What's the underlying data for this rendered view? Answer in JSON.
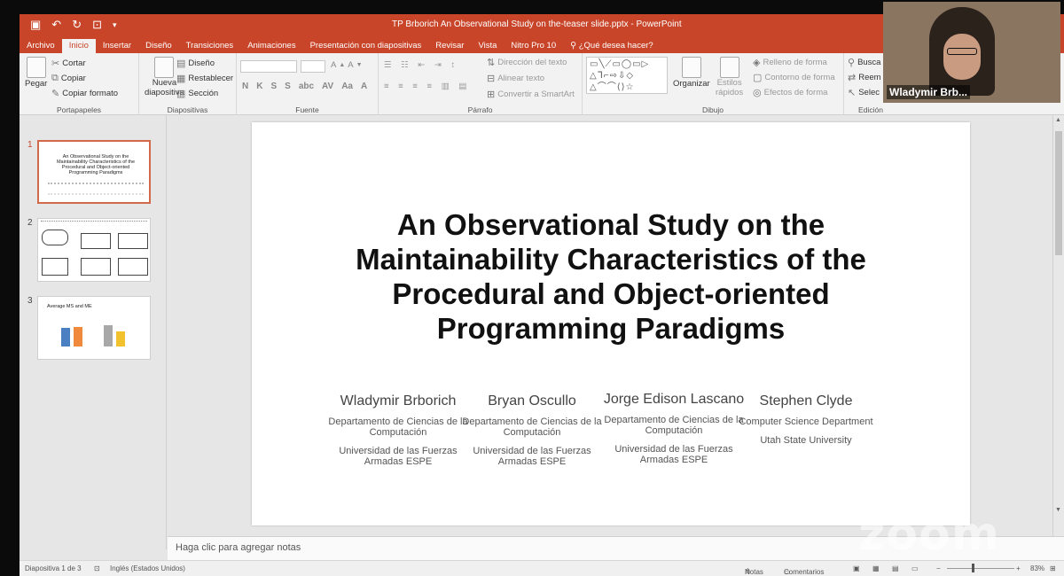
{
  "window": {
    "title": "TP Brborich An Observational Study on the-teaser slide.pptx - PowerPoint",
    "qat_icons": [
      "save-icon",
      "undo-icon",
      "redo-icon",
      "present-icon"
    ]
  },
  "tabs": [
    "Archivo",
    "Inicio",
    "Insertar",
    "Diseño",
    "Transiciones",
    "Animaciones",
    "Presentación con diapositivas",
    "Revisar",
    "Vista",
    "Nitro Pro 10",
    "¿Qué desea hacer?"
  ],
  "ribbon": {
    "clipboard": {
      "pegar": "Pegar",
      "cortar": "Cortar",
      "copiar": "Copiar",
      "copiar_formato": "Copiar formato",
      "label": "Portapapeles"
    },
    "slides": {
      "nueva": "Nueva",
      "diapositiva": "diapositiva",
      "diseno": "Diseño",
      "restablecer": "Restablecer",
      "seccion": "Sección",
      "label": "Diapositivas"
    },
    "font": {
      "label": "Fuente",
      "formats": [
        "N",
        "K",
        "S",
        "S",
        "abc",
        "AV",
        "Aa",
        "A"
      ]
    },
    "paragraph": {
      "direccion": "Dirección del texto",
      "alinear": "Alinear texto",
      "smartart": "Convertir a SmartArt",
      "label": "Párrafo"
    },
    "drawing": {
      "organizar": "Organizar",
      "estilos": "Estilos",
      "rapidos": "rápidos",
      "relleno": "Relleno de forma",
      "contorno": "Contorno de forma",
      "efectos": "Efectos de forma",
      "label": "Dibujo"
    },
    "editing": {
      "buscar": "Busca",
      "reemplazar": "Reem",
      "seleccionar": "Selec",
      "label": "Edición"
    }
  },
  "thumbnails": {
    "numbers": [
      "1",
      "2",
      "3"
    ],
    "slide1_title": "An Observational Study on the Maintainability Characteristics of the Procedural and Object-oriented Programming Paradigms",
    "slide3_title": "Average MS and ME",
    "slide3_values": [
      0.55,
      0.58,
      0.62,
      0.44
    ]
  },
  "slide": {
    "title_lines": [
      "An Observational Study on the",
      "Maintainability Characteristics of the",
      "Procedural and Object-oriented",
      "Programming Paradigms"
    ],
    "authors": [
      {
        "name": "Wladymir Brborich",
        "dept": "Departamento de Ciencias de la Computación",
        "univ": "Universidad de las Fuerzas Armadas ESPE"
      },
      {
        "name": "Bryan Oscullo",
        "dept": "Departamento de Ciencias de la Computación",
        "univ": "Universidad de las Fuerzas Armadas ESPE"
      },
      {
        "name": "Jorge Edison Lascano",
        "dept": "Departamento de Ciencias de la Computación",
        "univ": "Universidad de las Fuerzas Armadas ESPE"
      },
      {
        "name": "Stephen Clyde",
        "dept": "Computer Science Department",
        "univ": "Utah State University"
      }
    ]
  },
  "notes": {
    "placeholder": "Haga clic para agregar notas"
  },
  "status": {
    "slide_info": "Diapositiva 1 de 3",
    "language": "Inglés (Estados Unidos)",
    "notas": "Notas",
    "comentarios": "Comentarios",
    "zoom": "83%"
  },
  "webcam": {
    "name": "Wladymir Brb..."
  },
  "watermark": "zoom",
  "colors": {
    "accent": "#c8452a",
    "selection": "#d2694b"
  }
}
